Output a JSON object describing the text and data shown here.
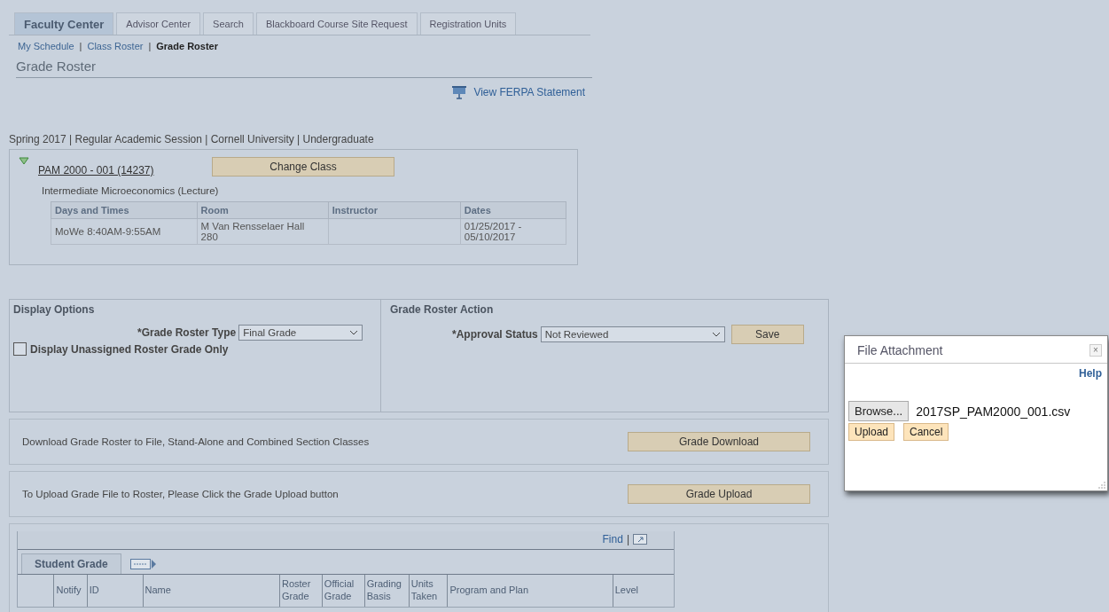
{
  "tabs": [
    {
      "label": "Faculty Center",
      "selected": true
    },
    {
      "label": "Advisor Center",
      "selected": false
    },
    {
      "label": "Search",
      "selected": false
    },
    {
      "label": "Blackboard Course Site Request",
      "selected": false
    },
    {
      "label": "Registration Units",
      "selected": false
    }
  ],
  "breadcrumbs": [
    {
      "label": "My Schedule",
      "current": false
    },
    {
      "label": "Class Roster",
      "current": false
    },
    {
      "label": "Grade Roster",
      "current": true
    }
  ],
  "breadcrumb_separator": "|",
  "page_title": "Grade Roster",
  "ferpa_link": "View FERPA Statement",
  "term_line": "Spring 2017 | Regular Academic Session | Cornell University | Undergraduate",
  "class_section": {
    "expanded": true,
    "class_link": "PAM 2000 - 001 (14237)",
    "change_button": "Change Class",
    "description": "Intermediate Microeconomics (Lecture)",
    "columns": [
      "Days and Times",
      "Room",
      "Instructor",
      "Dates"
    ],
    "rows": [
      {
        "days_and_times": "MoWe 8:40AM-9:55AM",
        "room": "M Van Rensselaer Hall 280",
        "dates": "01/25/2017 - 05/10/2017"
      }
    ]
  },
  "display_options": {
    "title": "Display Options",
    "roster_type": {
      "label": "*Grade Roster Type",
      "value": "Final Grade"
    },
    "unassigned_only": {
      "label": "Display Unassigned Roster Grade Only",
      "checked": false
    }
  },
  "grade_roster_action": {
    "title": "Grade Roster Action",
    "approval_status": {
      "label": "*Approval Status",
      "value": "Not Reviewed"
    },
    "save_button": "Save"
  },
  "download": {
    "text": "Download Grade Roster to File, Stand-Alone and Combined Section Classes",
    "button": "Grade Download"
  },
  "upload": {
    "text": "To Upload Grade File to Roster, Please Click the Grade Upload button",
    "button": "Grade Upload"
  },
  "student_grid": {
    "find_link": "Find",
    "separator": "|",
    "tab": "Student Grade",
    "columns": [
      "Notify",
      "ID",
      "Name",
      "Roster Grade",
      "Official Grade",
      "Grading Basis",
      "Units Taken",
      "Program and Plan",
      "Level"
    ]
  },
  "dialog": {
    "title": "File Attachment",
    "close": "×",
    "help_link": "Help",
    "browse_button": "Browse...",
    "file_name": "2017SP_PAM2000_001.csv",
    "buttons": [
      "Upload",
      "Cancel"
    ]
  }
}
